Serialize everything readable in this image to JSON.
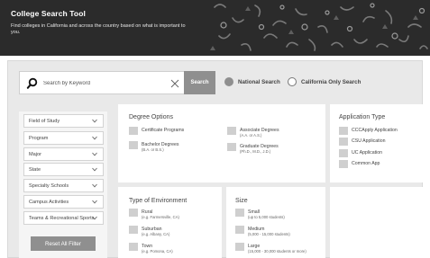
{
  "header": {
    "title": "College Search Tool",
    "subtitle": "Find colleges in California and across the country based on what is important to you."
  },
  "search": {
    "placeholder": "Search by Keyword",
    "button_label": "Search",
    "scope_options": [
      {
        "label": "National Search",
        "selected": true
      },
      {
        "label": "California Only Search",
        "selected": false
      }
    ]
  },
  "filters": {
    "dropdowns": [
      "Field of Study",
      "Program",
      "Major",
      "State",
      "Specialty Schools",
      "Campus Activities",
      "Teams & Recreational Sports"
    ],
    "reset_label": "Reset All Filter"
  },
  "degree_options": {
    "title": "Degree Options",
    "items": [
      {
        "label": "Certificate Programs",
        "sub": ""
      },
      {
        "label": "Associate Degrees",
        "sub": "(A.A. or A.S.)"
      },
      {
        "label": "Bachelor Degrees",
        "sub": "(B.A. or B.S.)"
      },
      {
        "label": "Graduate Degrees",
        "sub": "(Ph.D., M.D., J.D.)"
      }
    ]
  },
  "application_type": {
    "title": "Application Type",
    "items": [
      "CCCApply Application",
      "CSU Application",
      "UC Application",
      "Common App"
    ]
  },
  "environment": {
    "title": "Type of Environment",
    "items": [
      {
        "label": "Rural",
        "sub": "(e.g. Farmersville, CA)"
      },
      {
        "label": "Suburban",
        "sub": "(e.g. Albany, CA)"
      },
      {
        "label": "Town",
        "sub": "(e.g. Pomona, CA)"
      }
    ]
  },
  "size": {
    "title": "Size",
    "items": [
      {
        "label": "Small",
        "sub": "(up to 5,000 students)"
      },
      {
        "label": "Medium",
        "sub": "(5,000 - 15,000 students)"
      },
      {
        "label": "Large",
        "sub": "(15,000 - 30,000 students or more)"
      }
    ]
  }
}
